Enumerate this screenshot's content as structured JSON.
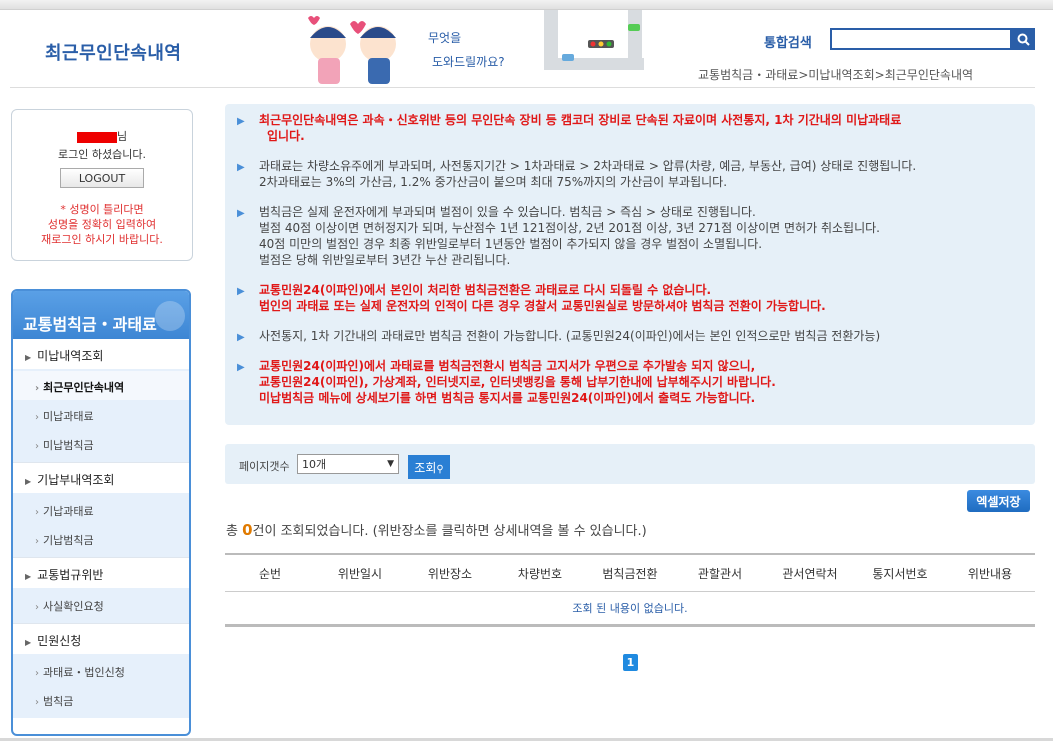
{
  "header": {
    "page_title": "최근무인단속내역",
    "search_label": "통합검색",
    "search_value": "",
    "mascot_text_1": "무엇을",
    "mascot_text_2": "도와드릴까요?",
    "breadcrumb": [
      "교통범칙금・과태료",
      ">",
      "미납내역조회",
      ">",
      "최근무인단속내역"
    ]
  },
  "login": {
    "name_suffix": "님",
    "message": "로그인 하셨습니다.",
    "logout_label": "LOGOUT",
    "warning_lines": [
      "* 성명이 틀리다면",
      "성명을 정확히 입력하여",
      "재로그인 하시기 바랍니다."
    ]
  },
  "sidebar": {
    "title": "교통범칙금・과태료",
    "groups": [
      {
        "label": "미납내역조회",
        "items": [
          "최근무인단속내역",
          "미납과태료",
          "미납범칙금"
        ]
      },
      {
        "label": "기납부내역조회",
        "items": [
          "기납과태료",
          "기납범칙금"
        ]
      },
      {
        "label": "교통법규위반",
        "items": [
          "사실확인요청"
        ]
      },
      {
        "label": "민원신청",
        "items": [
          "과태료・법인신청",
          "범칙금"
        ]
      }
    ],
    "active_item": "최근무인단속내역"
  },
  "notice": {
    "items": [
      {
        "red": true,
        "lines": [
          "최근무인단속내역은 과속・신호위반 등의 무인단속 장비 등 캠코더 장비로 단속된 자료이며 사전통지, 1차 기간내의 미납과태료",
          "입니다."
        ]
      },
      {
        "red": false,
        "lines": [
          "과태료는 차량소유주에게 부과되며, 사전통지기간 > 1차과태료 > 2차과태료 > 압류(차량, 예금, 부동산, 급여) 상태로 진행됩니다.",
          "2차과태료는 3%의 가산금, 1.2% 중가산금이 붙으며 최대 75%까지의 가산금이 부과됩니다."
        ]
      },
      {
        "red": false,
        "lines": [
          "범칙금은 실제 운전자에게 부과되며 벌점이 있을 수 있습니다. 범칙금 > 즉심 > 상태로 진행됩니다.",
          "벌점 40점 이상이면 면허정지가 되며, 누산점수 1년 121점이상, 2년 201점 이상, 3년 271점 이상이면 면허가 취소됩니다.",
          "40점 미만의 벌점인 경우 최종 위반일로부터 1년동안 벌점이 추가되지 않을 경우 벌점이 소멸됩니다.",
          "벌점은 당해 위반일로부터 3년간 누산 관리됩니다."
        ]
      },
      {
        "red": true,
        "lines": [
          "교통민원24(이파인)에서 본인이 처리한 범칙금전환은 과태료로 다시 되돌릴 수 없습니다.",
          "법인의 과태료 또는 실제 운전자의 인적이 다른 경우 경찰서 교통민원실로 방문하셔야 범칙금 전환이 가능합니다."
        ]
      },
      {
        "red": false,
        "lines": [
          "사전통지, 1차 기간내의 과태료만 범칙금 전환이 가능합니다. (교통민원24(이파인)에서는 본인 인적으로만 범칙금 전환가능)"
        ]
      },
      {
        "red": true,
        "lines": [
          "교통민원24(이파인)에서 과태료를 범칙금전환시 범칙금 고지서가 우편으로 추가발송 되지 않으니,",
          "교통민원24(이파인), 가상계좌, 인터넷지로, 인터넷뱅킹을 통해 납부기한내에 납부해주시기 바랍니다.",
          "미납범칙금 메뉴에 상세보기를 하면 범칙금 통지서를 교통민원24(이파인)에서 출력도 가능합니다."
        ]
      }
    ]
  },
  "filter": {
    "label": "페이지갯수",
    "selected": "10개",
    "query_label": "조회"
  },
  "excel_label": "엑셀저장",
  "result": {
    "prefix": "총",
    "count": "0",
    "suffix": "건이 조회되었습니다. (위반장소를 클릭하면 상세내역을 볼 수 있습니다.)"
  },
  "table": {
    "columns": [
      "순번",
      "위반일시",
      "위반장소",
      "차량번호",
      "범칙금전환",
      "관할관서",
      "관서연락처",
      "통지서번호",
      "위반내용"
    ],
    "empty_message": "조회 된 내용이 없습니다."
  },
  "pagination": {
    "current": "1"
  },
  "colors": {
    "primary": "#2a5ea8",
    "accent_orange": "#e07a00",
    "notice_red": "#e01818",
    "notice_bg": "#e6f0f8"
  }
}
